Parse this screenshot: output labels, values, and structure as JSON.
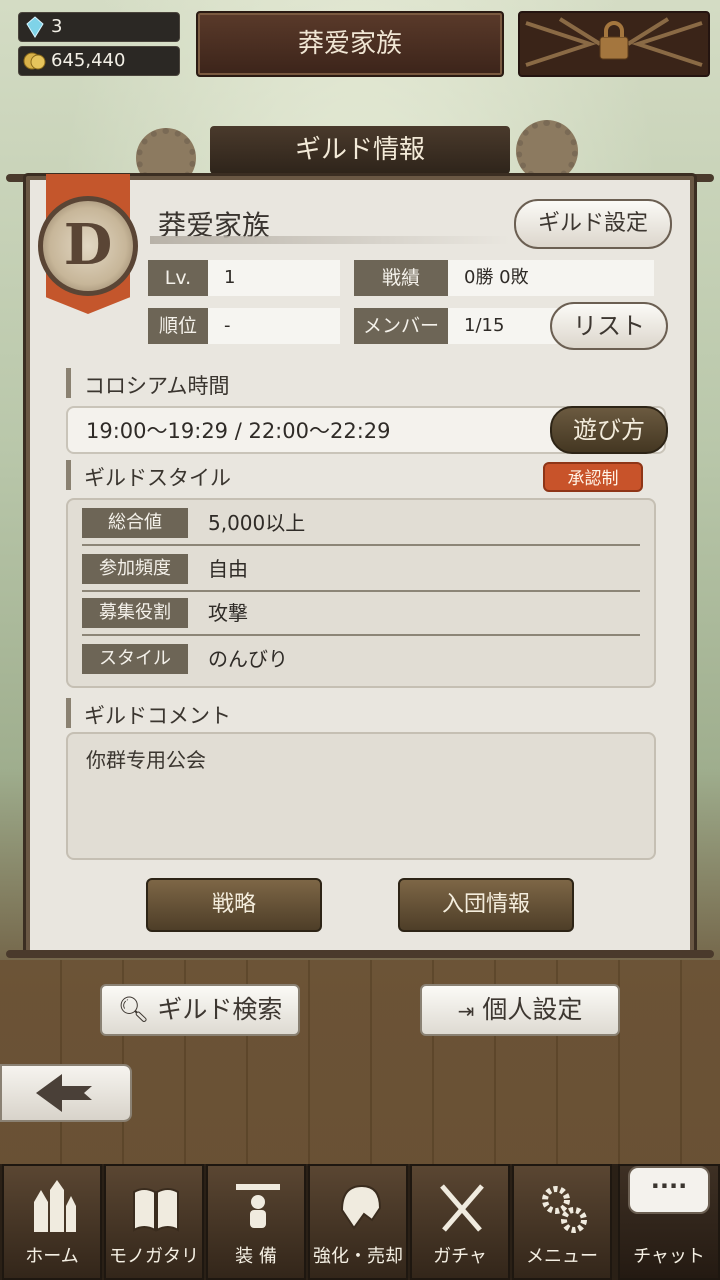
{
  "resources": {
    "crystals": "3",
    "gold": "645,440"
  },
  "header": {
    "guild_title": "莽爱家族"
  },
  "panel": {
    "title": "ギルド情報",
    "emblem_letter": "D",
    "guild_name": "莽爱家族",
    "settings_button": "ギルド設定",
    "stats": {
      "level_label": "Lv.",
      "level_value": "1",
      "record_label": "戦績",
      "record_value": "0勝 0敗",
      "rank_label": "順位",
      "rank_value": "-",
      "members_label": "メンバー",
      "members_value": "1/15",
      "list_button": "リスト"
    },
    "colosseum": {
      "title": "コロシアム時間",
      "times": "19:00～19:29 / 22:00～22:29",
      "howto_button": "遊び方"
    },
    "guild_style": {
      "title": "ギルドスタイル",
      "badge": "承認制",
      "rows": [
        {
          "label": "総合値",
          "value": "5,000以上"
        },
        {
          "label": "参加頻度",
          "value": "自由"
        },
        {
          "label": "募集役割",
          "value": "攻撃"
        },
        {
          "label": "スタイル",
          "value": "のんびり"
        }
      ]
    },
    "comment": {
      "title": "ギルドコメント",
      "text": "你群专用公会"
    },
    "strategy_button": "戦略",
    "join_info_button": "入団情報"
  },
  "actions": {
    "guild_search": "ギルド検索",
    "personal_settings": "個人設定"
  },
  "nav": {
    "items": [
      {
        "label": "ホーム",
        "icon": "castle-icon"
      },
      {
        "label": "モノガタリ",
        "icon": "book-icon"
      },
      {
        "label": "装 備",
        "icon": "equipment-icon"
      },
      {
        "label": "強化・売却",
        "icon": "helmet-icon"
      },
      {
        "label": "ガチャ",
        "icon": "swords-icon"
      },
      {
        "label": "メニュー",
        "icon": "gears-icon"
      },
      {
        "label": "チャット",
        "icon": "chat-icon"
      }
    ],
    "chat_bubble": "····"
  },
  "colors": {
    "accent": "#c8532a",
    "panel": "#e9e6df",
    "label_bg": "#6d6556"
  }
}
